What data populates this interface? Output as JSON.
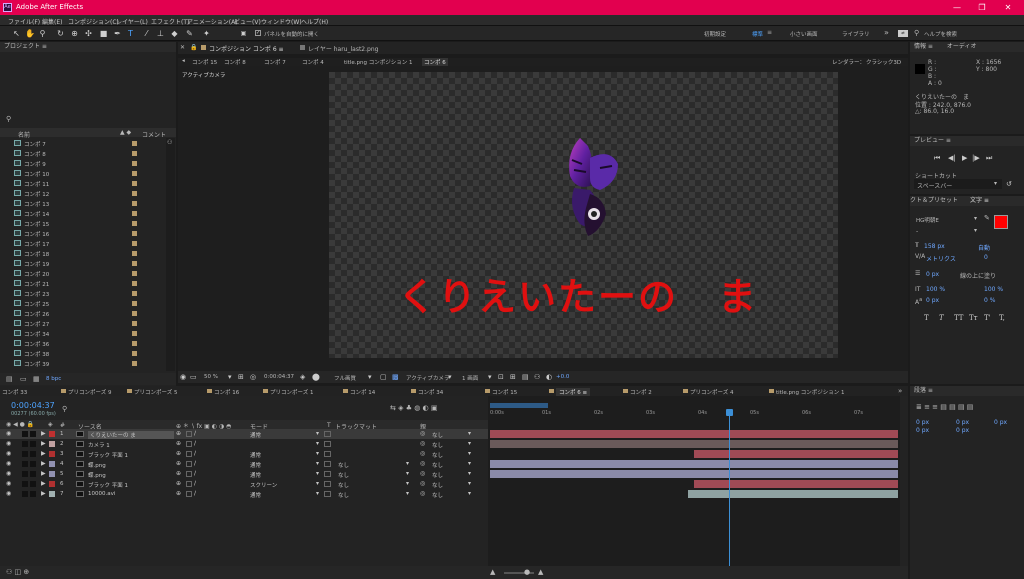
{
  "app": {
    "title": "Adobe After Effects",
    "icon_text": "Ae"
  },
  "window": {
    "min": "—",
    "max": "❐",
    "close": "✕"
  },
  "menu": [
    "ファイル(F)",
    "編集(E)",
    "コンポジション(C)",
    "レイヤー(L)",
    "エフェクト(T)",
    "アニメーション(A)",
    "ビュー(V)",
    "ウィンドウ(W)",
    "ヘルプ(H)"
  ],
  "toolbar": {
    "auto_open": "パネルを自動的に開く",
    "workspaces": [
      "初期設定",
      "標準",
      "小さい画面",
      "ライブラリ"
    ],
    "help_search": "ヘルプを検索",
    "more": "»"
  },
  "project": {
    "title": "プロジェクト  ≡",
    "search_icon": "⚲",
    "col_name": "名前",
    "col_comment": "コメント",
    "items": [
      "コンポ 7",
      "コンポ 8",
      "コンポ 9",
      "コンポ 10",
      "コンポ 11",
      "コンポ 12",
      "コンポ 13",
      "コンポ 14",
      "コンポ 15",
      "コンポ 16",
      "コンポ 17",
      "コンポ 18",
      "コンポ 19",
      "コンポ 20",
      "コンポ 21",
      "コンポ 23",
      "コンポ 25",
      "コンポ 26",
      "コンポ 27",
      "コンポ 34",
      "コンポ 36",
      "コンポ 38",
      "コンポ 39"
    ],
    "bpc": "8 bpc"
  },
  "viewer": {
    "tab": "コンポジション コンポ 6  ≡",
    "layer_tab": "レイヤー haru_last2.png",
    "breadcrumb": [
      "コンポ 15",
      "コンポ 8",
      "コンポ 7",
      "コンポ 4",
      "title.png コンポジション 1",
      "コンポ 6"
    ],
    "renderer": "レンダラー：",
    "renderer_val": "クラシック3D",
    "active_camera": "アクティブカメラ",
    "canvas_text": "くりえいたーの　ま",
    "zoom": "50 %",
    "timecode": "0:00:04:37",
    "quality": "フル画質",
    "camera": "アクティブカメラ",
    "views": "1 画面",
    "exposure": "+0.0"
  },
  "info": {
    "tab": "情報  ≡",
    "tab2": "オーディオ",
    "r": "R :",
    "g": "G :",
    "b": "B :",
    "a": "A : 0",
    "x": "X : 1656",
    "y": "Y : 800",
    "layer_name": "くりえいたーの　ま",
    "pos": "位置 : 242.0, 876.0",
    "delta": "△: 86.0, 16.0"
  },
  "preview": {
    "tab": "プレビュー  ≡",
    "shortcut": "ショートカット",
    "key": "スペースバー"
  },
  "char": {
    "tab1": "クト＆プリセット",
    "tab2": "文字  ≡",
    "font": "HG明朝E",
    "style": "-",
    "size": "158 px",
    "leading": "自動",
    "kern": "メトリクス",
    "track": "0",
    "stroke": "0 px",
    "stroke_mode": "線の上に塗り",
    "vscale": "100 %",
    "hscale": "100 %",
    "baseline": "0 px",
    "tsume": "0 %",
    "styles": [
      "T",
      "T",
      "TT",
      "Tт",
      "T'",
      "T,"
    ]
  },
  "para": {
    "tab": "段落  ≡",
    "indent": [
      "0 px",
      "0 px",
      "0 px",
      "0 px",
      "0 px"
    ]
  },
  "timeline": {
    "tabs": [
      "コンポ 33",
      "プリコンポーズ 9",
      "プリコンポーズ 5",
      "コンポ 16",
      "プリコンポーズ 1",
      "コンポ 14",
      "コンポ 34",
      "コンポ 15",
      "コンポ 6  ≡",
      "コンポ 2",
      "プリコンポーズ 4",
      "title.png コンポジション 1"
    ],
    "timecode": "0:00:04:37",
    "fps": "00277 (60.00 fps)",
    "col_source": "ソース名",
    "col_mode": "モード",
    "col_t": "T",
    "col_track": "トラックマット",
    "col_parent": "親",
    "ruler": [
      "0:00s",
      "01s",
      "02s",
      "03s",
      "04s",
      "05s",
      "06s",
      "07s"
    ],
    "layers": [
      {
        "n": "1",
        "name": "くりえいたーの ま",
        "mode": "通常",
        "track": "",
        "parent": "なし",
        "color": "#c03030",
        "sel": true
      },
      {
        "n": "2",
        "name": "カメラ 1",
        "mode": "",
        "track": "",
        "parent": "なし",
        "color": "#c0a0a0",
        "sel": false
      },
      {
        "n": "3",
        "name": "ブラック 平面 1",
        "mode": "通常",
        "track": "",
        "parent": "なし",
        "color": "#b03030",
        "sel": false
      },
      {
        "n": "4",
        "name": "蝶.png",
        "mode": "通常",
        "track": "なし",
        "parent": "なし",
        "color": "#9090b0",
        "sel": false
      },
      {
        "n": "5",
        "name": "蝶.png",
        "mode": "通常",
        "track": "なし",
        "parent": "なし",
        "color": "#9090b0",
        "sel": false
      },
      {
        "n": "6",
        "name": "ブラック 平面 1",
        "mode": "スクリーン",
        "track": "なし",
        "parent": "なし",
        "color": "#b03030",
        "sel": false
      },
      {
        "n": "7",
        "name": "10000.avi",
        "mode": "通常",
        "track": "なし",
        "parent": "なし",
        "color": "#a0b0b0",
        "sel": false
      }
    ]
  },
  "colors": {
    "accent": "#e2004f",
    "text_red": "#e01010",
    "label_tan": "#b79b6a"
  }
}
